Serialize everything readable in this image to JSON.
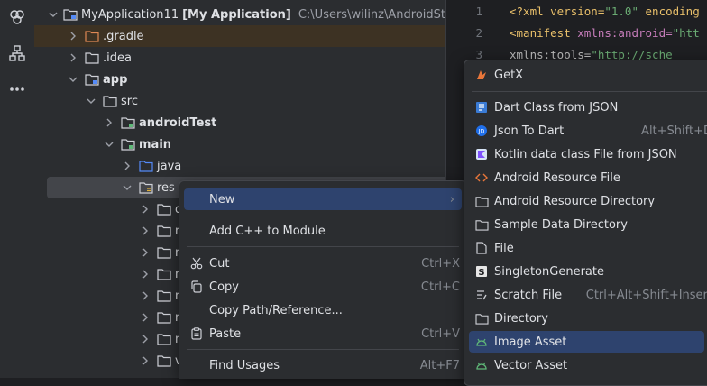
{
  "project_tree": {
    "rows": [
      {
        "name": "MyApplication11",
        "bold_suffix": "[My Application]",
        "path": "C:\\Users\\wilinz\\AndroidStudioPro"
      },
      {
        "name": ".gradle"
      },
      {
        "name": ".idea"
      },
      {
        "name": "app"
      },
      {
        "name": "src"
      },
      {
        "name": "androidTest"
      },
      {
        "name": "main"
      },
      {
        "name": "java"
      },
      {
        "name": "res"
      },
      {
        "name": "dr"
      },
      {
        "name": "m"
      },
      {
        "name": "m"
      },
      {
        "name": "m"
      },
      {
        "name": "m"
      },
      {
        "name": "m"
      },
      {
        "name": "m"
      },
      {
        "name": "va"
      }
    ]
  },
  "editor": {
    "line_numbers": [
      "1",
      "2",
      "3",
      "4"
    ],
    "lines": [
      {
        "p1": "<?xml version=",
        "p2": "\"1.0\"",
        "p3": " encoding"
      },
      {
        "p1": "<manifest ",
        "p2": "xmlns:android=",
        "p3": "\"htt"
      },
      {
        "p1": "    xmlns:tools=",
        "p2": "\"http://sche",
        "p3": ""
      }
    ]
  },
  "context_menu": {
    "items": [
      {
        "label": "New",
        "shortcut": ""
      },
      {
        "label": "Add C++ to Module",
        "shortcut": ""
      },
      {
        "label": "Cut",
        "shortcut": "Ctrl+X"
      },
      {
        "label": "Copy",
        "shortcut": "Ctrl+C"
      },
      {
        "label": "Copy Path/Reference...",
        "shortcut": ""
      },
      {
        "label": "Paste",
        "shortcut": "Ctrl+V"
      },
      {
        "label": "Find Usages",
        "shortcut": "Alt+F7"
      }
    ]
  },
  "new_submenu": {
    "items": [
      {
        "label": "GetX",
        "shortcut": ""
      },
      {
        "label": "Dart Class from JSON",
        "shortcut": ""
      },
      {
        "label": "Json To Dart",
        "shortcut": "Alt+Shift+D"
      },
      {
        "label": "Kotlin data class File from JSON",
        "shortcut": ""
      },
      {
        "label": "Android Resource File",
        "shortcut": ""
      },
      {
        "label": "Android Resource Directory",
        "shortcut": ""
      },
      {
        "label": "Sample Data Directory",
        "shortcut": ""
      },
      {
        "label": "File",
        "shortcut": ""
      },
      {
        "label": "SingletonGenerate",
        "shortcut": ""
      },
      {
        "label": "Scratch File",
        "shortcut": "Ctrl+Alt+Shift+Insert"
      },
      {
        "label": "Directory",
        "shortcut": ""
      },
      {
        "label": "Image Asset",
        "shortcut": ""
      },
      {
        "label": "Vector Asset",
        "shortcut": ""
      }
    ]
  },
  "colors": {
    "selection": "#2e436e",
    "folder": "#ced0d6",
    "android_green": "#5fb878",
    "accent_blue": "#548af7"
  }
}
